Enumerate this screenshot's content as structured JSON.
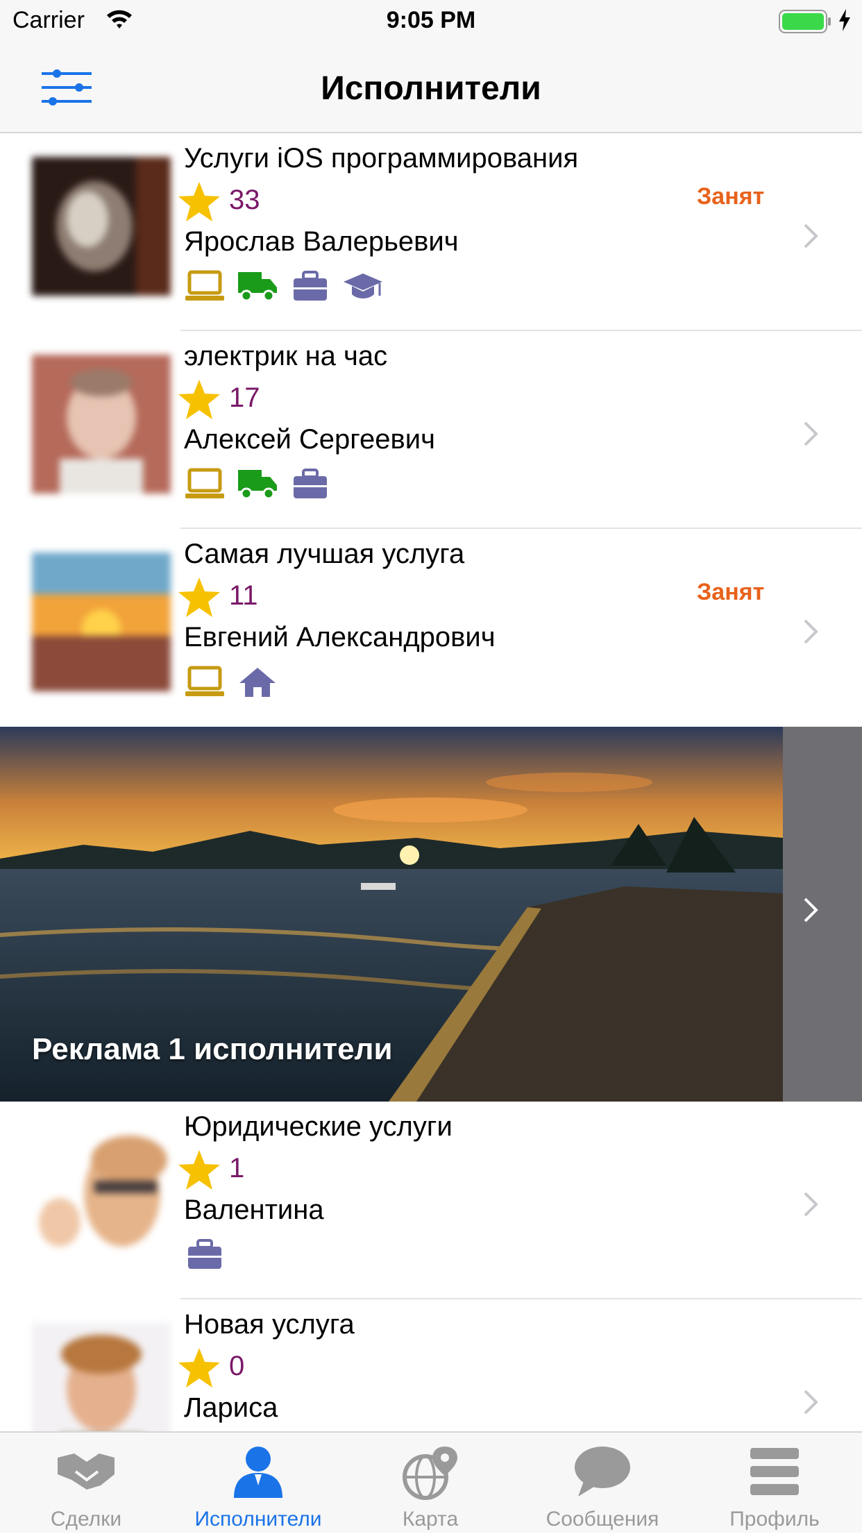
{
  "status_bar": {
    "carrier": "Carrier",
    "time": "9:05 PM"
  },
  "nav": {
    "title": "Исполнители"
  },
  "providers": [
    {
      "service": "Услуги iOS программирования",
      "rating": "33",
      "status": "Занят",
      "name": "Ярослав Валерьевич",
      "icons": [
        "laptop-icon",
        "truck-icon",
        "briefcase-icon",
        "graduation-cap-icon"
      ]
    },
    {
      "service": "электрик на час",
      "rating": "17",
      "status": "",
      "name": "Алексей Сергеевич",
      "icons": [
        "laptop-icon",
        "truck-icon",
        "briefcase-icon"
      ]
    },
    {
      "service": "Самая лучшая услуга",
      "rating": "11",
      "status": "Занят",
      "name": "Евгений Александрович",
      "icons": [
        "laptop-icon",
        "home-icon"
      ]
    },
    {
      "service": "Юридические услуги",
      "rating": "1",
      "status": "",
      "name": "Валентина",
      "icons": [
        "briefcase-icon"
      ]
    },
    {
      "service": "Новая услуга",
      "rating": "0",
      "status": "",
      "name": "Лариса",
      "icons": []
    }
  ],
  "ad": {
    "label": "Реклама 1 исполнители"
  },
  "tabs": [
    {
      "label": "Сделки",
      "icon": "handshake-icon",
      "active": false
    },
    {
      "label": "Исполнители",
      "icon": "person-icon",
      "active": true
    },
    {
      "label": "Карта",
      "icon": "globe-pin-icon",
      "active": false
    },
    {
      "label": "Сообщения",
      "icon": "chat-bubble-icon",
      "active": false
    },
    {
      "label": "Профиль",
      "icon": "menu-icon",
      "active": false
    }
  ],
  "colors": {
    "accent": "#1b73e8",
    "rating": "#7a1868",
    "busy": "#e8621b",
    "star": "#f6c100",
    "laptop": "#c69b12",
    "truck": "#1a9b1a",
    "briefcase": "#6b6aa8",
    "tab_inactive": "#9a9a9a"
  }
}
